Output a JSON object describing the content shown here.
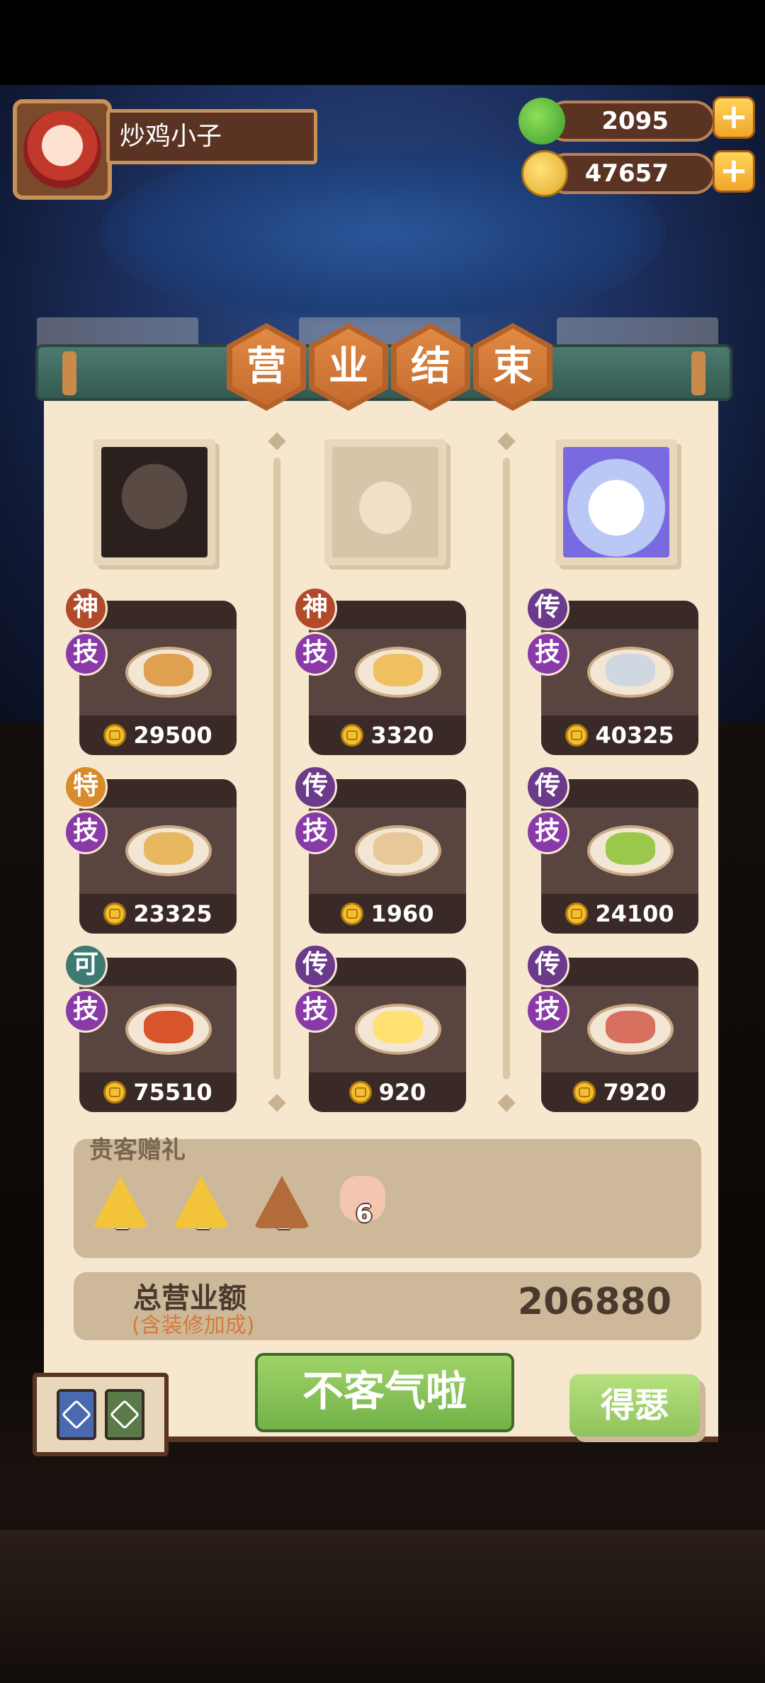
{
  "player": {
    "name": "炒鸡小子"
  },
  "resources": {
    "apples": "2095",
    "coins": "47657",
    "plus_symbol": "+"
  },
  "title": [
    "营",
    "业",
    "结",
    "束"
  ],
  "guests": [
    {
      "portrait": "black-lion-guest",
      "dishes": [
        {
          "tier": "神",
          "skill": "技",
          "amount": "29500",
          "food": "braised-chicken"
        },
        {
          "tier": "特",
          "skill": "技",
          "amount": "23325",
          "food": "fried-noodles"
        },
        {
          "tier": "可",
          "skill": "技",
          "amount": "75510",
          "food": "lobster-platter"
        }
      ]
    },
    {
      "portrait": "chef-boy-guest",
      "dishes": [
        {
          "tier": "神",
          "skill": "技",
          "amount": "3320",
          "food": "scallion-cake"
        },
        {
          "tier": "传",
          "skill": "技",
          "amount": "1960",
          "food": "flatbread"
        },
        {
          "tier": "传",
          "skill": "技",
          "amount": "920",
          "food": "fried-eggs"
        }
      ]
    },
    {
      "portrait": "white-bunny-guest",
      "dishes": [
        {
          "tier": "传",
          "skill": "技",
          "amount": "40325",
          "food": "tea-set"
        },
        {
          "tier": "传",
          "skill": "技",
          "amount": "24100",
          "food": "salad-bowl"
        },
        {
          "tier": "传",
          "skill": "技",
          "amount": "7920",
          "food": "stew-pot"
        }
      ]
    }
  ],
  "gifts": {
    "title": "贵客赠礼",
    "items": [
      {
        "icon": "gold-fish-triangle-icon",
        "count": "1",
        "color": "#f3c33a"
      },
      {
        "icon": "gold-fish-triangle-icon",
        "count": "1",
        "color": "#f3c33a"
      },
      {
        "icon": "bronze-triangle-icon",
        "count": "1",
        "color": "#b46b3a"
      },
      {
        "icon": "ham-icon",
        "count": "6",
        "color": "#f3c6b0"
      }
    ]
  },
  "total": {
    "label": "总营业额",
    "sublabel": "(含装修加成)",
    "value": "206880"
  },
  "buttons": {
    "main": "不客气啦",
    "secondary": "得瑟"
  },
  "colors": {
    "panel": "#f7e7cf",
    "card": "#4b3733",
    "accent_green": "#72b247",
    "hex_orange": "#c46b2e"
  }
}
